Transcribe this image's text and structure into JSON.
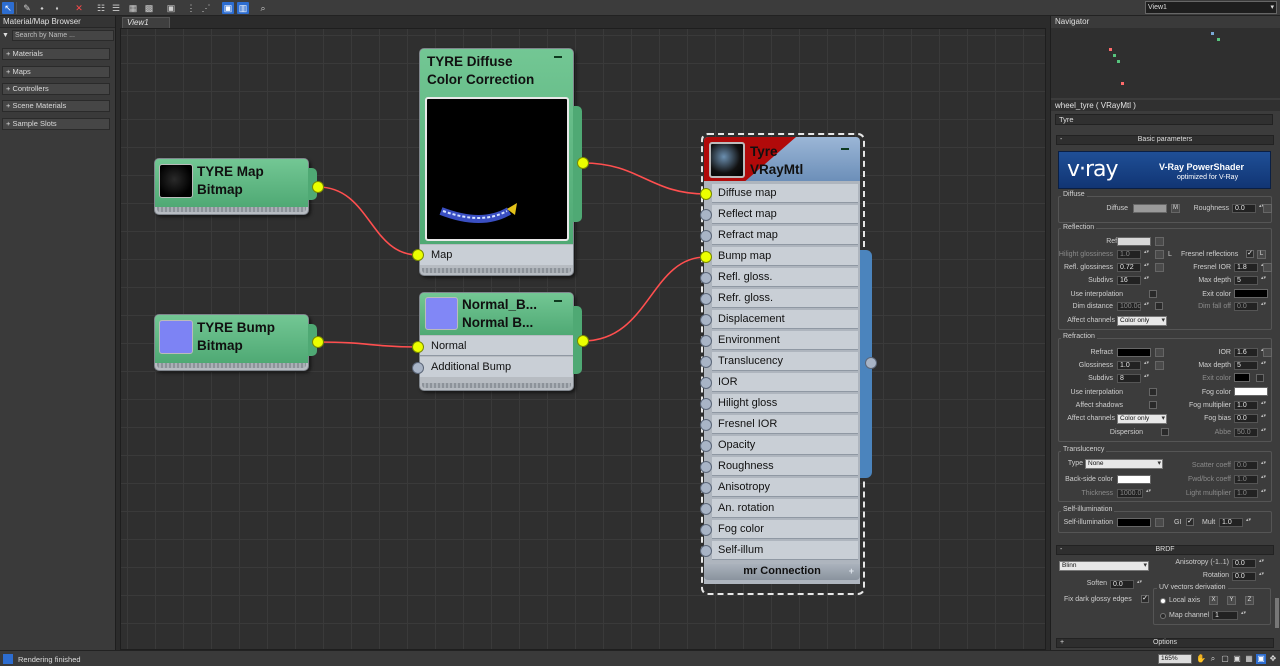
{
  "toolbar": {
    "view_select": "View1"
  },
  "browser": {
    "title": "Material/Map Browser",
    "search_placeholder": "Search by Name ...",
    "categories": [
      "+ Materials",
      "+ Maps",
      "+ Controllers",
      "+ Scene Materials",
      "+ Sample Slots"
    ]
  },
  "view_tab": "View1",
  "nodes": {
    "tyre_map": {
      "title1": "TYRE Map",
      "title2": "Bitmap"
    },
    "tyre_bump": {
      "title1": "TYRE Bump",
      "title2": "Bitmap"
    },
    "color_correction": {
      "title1": "TYRE Diffuse",
      "title2": "Color Correction",
      "slot": "Map"
    },
    "normal_bump": {
      "title1": "Normal_B...",
      "title2": "Normal B...",
      "slot_normal": "Normal",
      "slot_additional": "Additional Bump"
    },
    "vray": {
      "title1": "Tyre",
      "title2": "VRayMtl",
      "footer": "mr Connection",
      "slots": [
        "Diffuse map",
        "Reflect map",
        "Refract map",
        "Bump map",
        "Refl. gloss.",
        "Refr. gloss.",
        "Displacement",
        "Environment",
        "Translucency",
        "IOR",
        "Hilight gloss",
        "Fresnel IOR",
        "Opacity",
        "Roughness",
        "Anisotropy",
        "An. rotation",
        "Fog color",
        "Self-illum"
      ]
    }
  },
  "navigator": {
    "title": "Navigator"
  },
  "params": {
    "title": "wheel_tyre  ( VRayMtl )",
    "material_name": "Tyre",
    "basic_rollout": "Basic parameters",
    "banner": {
      "logo": "v·ray",
      "product": "V-Ray PowerShader",
      "tagline": "optimized for V-Ray"
    },
    "diffuse": {
      "group": "Diffuse",
      "diffuse_label": "Diffuse",
      "m_btn": "M",
      "roughness_label": "Roughness",
      "roughness": "0.0"
    },
    "reflection": {
      "group": "Reflection",
      "reflect": "Reflect",
      "hilight_glossiness": "Hilight glossiness",
      "hilight_glossiness_val": "1.0",
      "l_btn": "L",
      "fresnel_reflections": "Fresnel reflections",
      "refl_glossiness": "Refl. glossiness",
      "refl_glossiness_val": "0.72",
      "fresnel_ior": "Fresnel IOR",
      "fresnel_ior_val": "1.8",
      "subdivs": "Subdivs",
      "subdivs_val": "16",
      "max_depth": "Max depth",
      "max_depth_val": "5",
      "use_interpolation": "Use interpolation",
      "exit_color": "Exit color",
      "dim_distance": "Dim distance",
      "dim_distance_val": "100.0c",
      "dim_falloff": "Dim fall off",
      "dim_falloff_val": "0.0",
      "affect_channels": "Affect channels",
      "affect_channels_val": "Color only"
    },
    "refraction": {
      "group": "Refraction",
      "refract": "Refract",
      "ior": "IOR",
      "ior_val": "1.6",
      "glossiness": "Glossiness",
      "glossiness_val": "1.0",
      "max_depth": "Max depth",
      "max_depth_val": "5",
      "subdivs": "Subdivs",
      "subdivs_val": "8",
      "exit_color": "Exit color",
      "use_interpolation": "Use interpolation",
      "fog_color": "Fog color",
      "affect_shadows": "Affect shadows",
      "fog_multiplier": "Fog multiplier",
      "fog_multiplier_val": "1.0",
      "affect_channels": "Affect channels",
      "affect_channels_val": "Color only",
      "fog_bias": "Fog bias",
      "fog_bias_val": "0.0",
      "dispersion": "Dispersion",
      "abbe": "Abbe",
      "abbe_val": "50.0"
    },
    "translucency": {
      "group": "Translucency",
      "type": "Type",
      "type_val": "None",
      "scatter_coeff": "Scatter coeff",
      "scatter_coeff_val": "0.0",
      "backside_color": "Back-side color",
      "fwd_bck_coeff": "Fwd/bck coeff",
      "fwd_bck_coeff_val": "1.0",
      "thickness": "Thickness",
      "thickness_val": "1000.0",
      "light_multiplier": "Light multiplier",
      "light_multiplier_val": "1.0"
    },
    "self_illumination": {
      "group": "Self-illumination",
      "label": "Self-illumination",
      "gi": "GI",
      "mult": "Mult",
      "mult_val": "1.0"
    },
    "brdf": {
      "rollout": "BRDF",
      "type_val": "Blinn",
      "anisotropy": "Anisotropy (-1..1)",
      "anisotropy_val": "0.0",
      "rotation": "Rotation",
      "rotation_val": "0.0",
      "soften": "Soften",
      "soften_val": "0.0",
      "uv_derivation": "UV vectors derivation",
      "fix_dark": "Fix dark glossy edges",
      "local_axis": "Local axis",
      "x": "X",
      "y": "Y",
      "z": "Z",
      "map_channel": "Map channel",
      "map_channel_val": "1"
    },
    "options_rollout": "Options"
  },
  "statusbar": {
    "text": "Rendering finished",
    "zoom": "165%"
  },
  "colors": {
    "accent": "#2d6dd0",
    "node_green": "#5cb67f",
    "wire": "#ff4f4f",
    "port_active": "#ebff00",
    "vray_blue": "#4b84bd"
  }
}
